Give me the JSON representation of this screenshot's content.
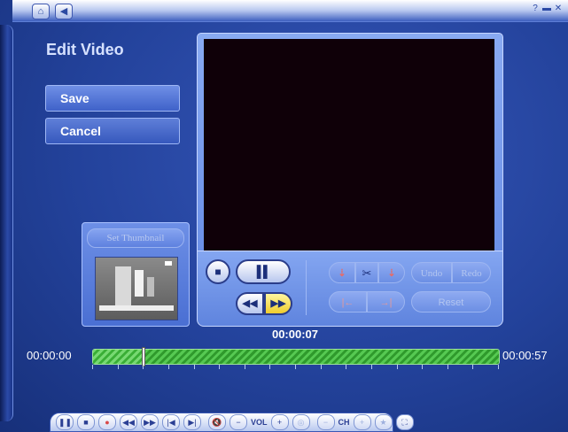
{
  "topbar": {
    "icons": [
      "home-icon",
      "back-icon"
    ],
    "window_controls": [
      "help-icon",
      "minimize-icon",
      "close-icon"
    ]
  },
  "page": {
    "title": "Edit Video"
  },
  "sidebar": {
    "save_label": "Save",
    "cancel_label": "Cancel"
  },
  "thumbnail": {
    "set_thumbnail_label": "Set Thumbnail"
  },
  "editor": {
    "undo_label": "Undo",
    "redo_label": "Redo",
    "reset_label": "Reset"
  },
  "timeline": {
    "current_time": "00:00:07",
    "start_time": "00:00:00",
    "end_time": "00:00:57",
    "position_seconds": 7,
    "duration_seconds": 57
  },
  "transport": {
    "vol_label": "VOL",
    "ch_label": "CH"
  },
  "colors": {
    "accent": "#3556b8",
    "timeline_green": "#3eb43a",
    "ff_highlight": "#f0cc2d"
  }
}
